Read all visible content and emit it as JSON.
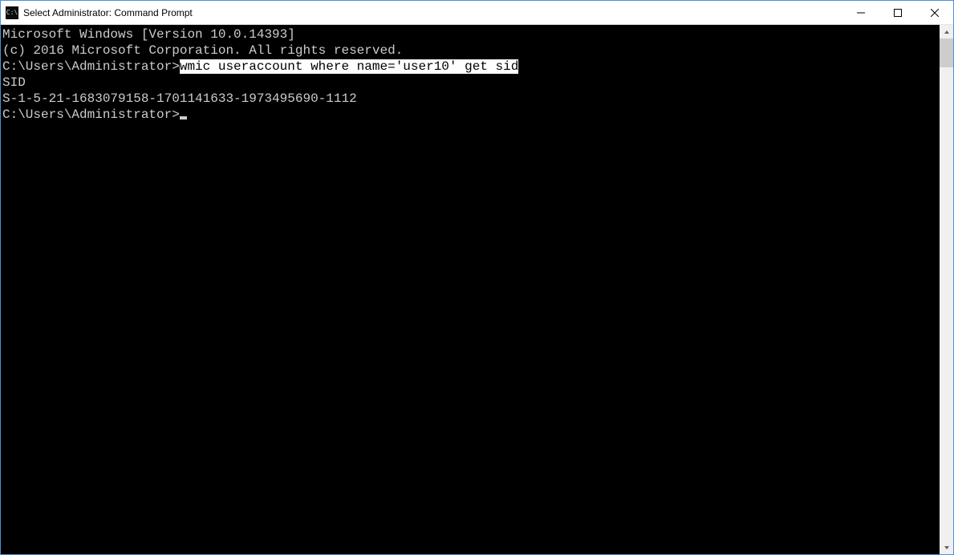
{
  "window": {
    "icon_hint": "C:\\",
    "title": "Select Administrator: Command Prompt"
  },
  "terminal": {
    "line1": "Microsoft Windows [Version 10.0.14393]",
    "line2": "(c) 2016 Microsoft Corporation. All rights reserved.",
    "blank1": "",
    "prompt1_prefix": "C:\\Users\\Administrator>",
    "prompt1_command": "wmic useraccount where name='user10' get sid",
    "output_header": "SID",
    "output_value": "S-1-5-21-1683079158-1701141633-1973495690-1112",
    "blank2": "",
    "blank3": "",
    "prompt2_prefix": "C:\\Users\\Administrator>"
  }
}
